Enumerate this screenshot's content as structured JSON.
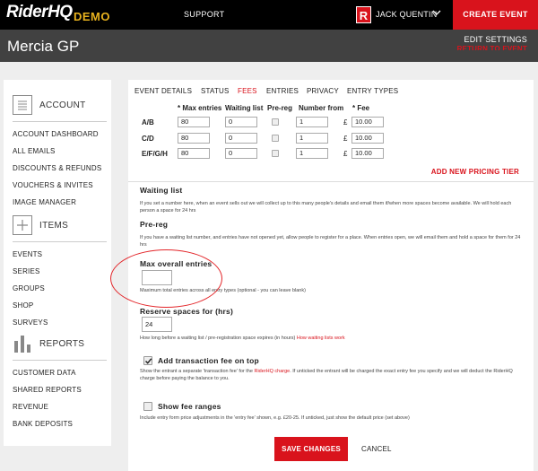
{
  "topbar": {
    "logo": "RiderHQ",
    "logo_badge": "DEMO",
    "support": "SUPPORT",
    "avatar_letter": "R",
    "user_name": "JACK QUENTIN",
    "create_event": "CREATE EVENT"
  },
  "header": {
    "event_title": "Mercia GP",
    "edit_settings": "EDIT SETTINGS",
    "return_link": "RETURN TO EVENT"
  },
  "sidebar": {
    "account": {
      "title": "ACCOUNT",
      "items": [
        "ACCOUNT DASHBOARD",
        "ALL EMAILS",
        "DISCOUNTS & REFUNDS",
        "VOUCHERS & INVITES",
        "IMAGE MANAGER"
      ]
    },
    "items_section": {
      "title": "ITEMS",
      "items": [
        "EVENTS",
        "SERIES",
        "GROUPS",
        "SHOP",
        "SURVEYS"
      ]
    },
    "reports": {
      "title": "REPORTS",
      "items": [
        "CUSTOMER DATA",
        "SHARED REPORTS",
        "REVENUE",
        "BANK DEPOSITS"
      ]
    }
  },
  "tabs": [
    {
      "label": "EVENT DETAILS",
      "active": false
    },
    {
      "label": "STATUS",
      "active": false
    },
    {
      "label": "FEES",
      "active": true
    },
    {
      "label": "ENTRIES",
      "active": false
    },
    {
      "label": "PRIVACY",
      "active": false
    },
    {
      "label": "ENTRY TYPES",
      "active": false
    }
  ],
  "pricing": {
    "columns": [
      "* Max entries",
      "Waiting list",
      "Pre-reg",
      "Number from",
      "* Fee"
    ],
    "currency": "£",
    "rows": [
      {
        "label": "A/B",
        "max_entries": "80",
        "waiting_list": "0",
        "pre_reg": false,
        "number_from": "1",
        "fee": "10.00"
      },
      {
        "label": "C/D",
        "max_entries": "80",
        "waiting_list": "0",
        "pre_reg": false,
        "number_from": "1",
        "fee": "10.00"
      },
      {
        "label": "E/F/G/H",
        "max_entries": "80",
        "waiting_list": "0",
        "pre_reg": false,
        "number_from": "1",
        "fee": "10.00"
      }
    ],
    "add_tier": "ADD NEW PRICING TIER"
  },
  "waiting_list": {
    "label": "Waiting list",
    "help": "If you set a number here, when an event sells out we will collect up to this many people's details and email them if/when more spaces become available. We will hold each person a space for 24 hrs"
  },
  "pre_reg": {
    "label": "Pre-reg",
    "help": "If you have a waiting list number, and entries have not opened yet, allow people to register for a place. When entries open, we will email them and hold a space for them for 24 hrs"
  },
  "max_overall": {
    "label": "Max overall entries",
    "value": "",
    "help": "Maximum total entries across all entry types (optional - you can leave blank)"
  },
  "reserve": {
    "label": "Reserve spaces for (hrs)",
    "value": "24",
    "help": "How long before a waiting list / pre-registration space expires (in hours)",
    "help_link": "How waiting lists work"
  },
  "transaction_fee": {
    "label": "Add transaction fee on top",
    "checked": true,
    "help_before": "Show the entrant a separate 'transaction fee' for the",
    "help_link": "RiderHQ charge",
    "help_after": ". If unticked the entrant will be charged the exact entry fee you specify and we will deduct the RiderHQ charge before paying the balance to you."
  },
  "fee_ranges": {
    "label": "Show fee ranges",
    "checked": false,
    "help": "Include entry form price adjustments in the 'entry fee' shown, e.g. £20-25. If unticked, just show the default price (set above)"
  },
  "actions": {
    "save": "SAVE CHANGES",
    "cancel": "CANCEL"
  },
  "colors": {
    "brand_red": "#d9131c",
    "topbar_bg": "#000000",
    "header_bg": "#414141",
    "annotation_ring": "#e3262a"
  }
}
